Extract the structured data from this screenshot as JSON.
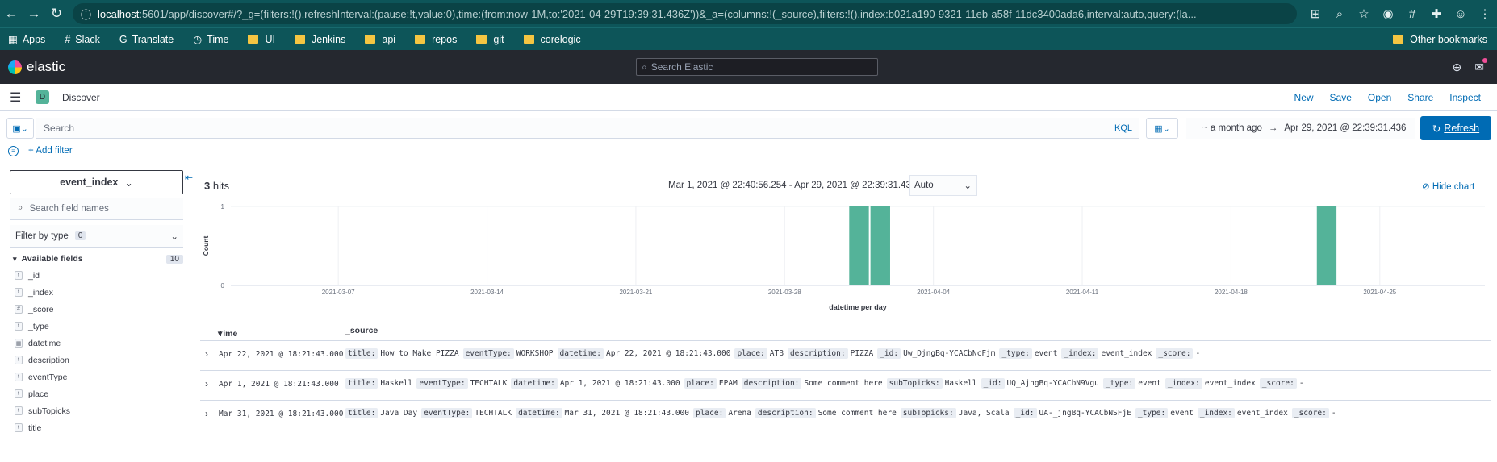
{
  "browser": {
    "url_host": "localhost",
    "url_path": ":5601/app/discover#/?_g=(filters:!(),refreshInterval:(pause:!t,value:0),time:(from:now-1M,to:'2021-04-29T19:39:31.436Z'))&_a=(columns:!(_source),filters:!(),index:b021a190-9321-11eb-a58f-11dc3400ada6,interval:auto,query:(la...",
    "bookmarks": [
      "Apps",
      "Slack",
      "Translate",
      "Time",
      "UI",
      "Jenkins",
      "api",
      "repos",
      "git",
      "corelogic"
    ],
    "other_bookmarks": "Other bookmarks"
  },
  "header": {
    "logo_text": "elastic",
    "search_placeholder": "Search Elastic"
  },
  "app_bar": {
    "badge": "D",
    "title": "Discover",
    "menu": [
      "New",
      "Save",
      "Open",
      "Share",
      "Inspect"
    ]
  },
  "query": {
    "placeholder": "Search",
    "kql": "KQL",
    "date_start": "~ a month ago",
    "date_arrow": "→",
    "date_end": "Apr 29, 2021 @ 22:39:31.436",
    "refresh_label": "Refresh",
    "add_filter": "+ Add filter"
  },
  "sidebar": {
    "index_pattern": "event_index",
    "field_search_placeholder": "Search field names",
    "filter_by_type": "Filter by type",
    "filter_count": "0",
    "available_label": "Available fields",
    "available_count": "10",
    "fields": [
      {
        "type": "t",
        "name": "_id"
      },
      {
        "type": "t",
        "name": "_index"
      },
      {
        "type": "#",
        "name": "_score"
      },
      {
        "type": "t",
        "name": "_type"
      },
      {
        "type": "cal",
        "name": "datetime"
      },
      {
        "type": "t",
        "name": "description"
      },
      {
        "type": "t",
        "name": "eventType"
      },
      {
        "type": "t",
        "name": "place"
      },
      {
        "type": "t",
        "name": "subTopicks"
      },
      {
        "type": "t",
        "name": "title"
      }
    ]
  },
  "results": {
    "hits_count": "3",
    "hits_label": "hits",
    "range": "Mar 1, 2021 @ 22:40:56.254 - Apr 29, 2021 @ 22:39:31.436",
    "interval": "Auto",
    "hide_chart": "Hide chart",
    "col_time": "Time",
    "col_source": "_source",
    "rows": [
      {
        "time": "Apr 22, 2021 @ 18:21:43.000",
        "pairs": [
          [
            "title:",
            "How to Make PIZZA"
          ],
          [
            "eventType:",
            "WORKSHOP"
          ],
          [
            "datetime:",
            "Apr 22, 2021 @ 18:21:43.000"
          ],
          [
            "place:",
            "ATB"
          ],
          [
            "description:",
            "PIZZA"
          ],
          [
            "_id:",
            "Uw_DjngBq-YCACbNcFjm"
          ],
          [
            "_type:",
            "event"
          ],
          [
            "_index:",
            "event_index"
          ],
          [
            "_score:",
            "-"
          ]
        ]
      },
      {
        "time": "Apr 1, 2021 @ 18:21:43.000",
        "pairs": [
          [
            "title:",
            "Haskell"
          ],
          [
            "eventType:",
            "TECHTALK"
          ],
          [
            "datetime:",
            "Apr 1, 2021 @ 18:21:43.000"
          ],
          [
            "place:",
            "EPAM"
          ],
          [
            "description:",
            "Some comment here"
          ],
          [
            "subTopicks:",
            "Haskell"
          ],
          [
            "_id:",
            "UQ_AjngBq-YCACbN9Vgu"
          ],
          [
            "_type:",
            "event"
          ],
          [
            "_index:",
            "event_index"
          ],
          [
            "_score:",
            "-"
          ]
        ]
      },
      {
        "time": "Mar 31, 2021 @ 18:21:43.000",
        "pairs": [
          [
            "title:",
            "Java Day"
          ],
          [
            "eventType:",
            "TECHTALK"
          ],
          [
            "datetime:",
            "Mar 31, 2021 @ 18:21:43.000"
          ],
          [
            "place:",
            "Arena"
          ],
          [
            "description:",
            "Some comment here"
          ],
          [
            "subTopicks:",
            "Java, Scala"
          ],
          [
            "_id:",
            "UA-_jngBq-YCACbNSFjE"
          ],
          [
            "_type:",
            "event"
          ],
          [
            "_index:",
            "event_index"
          ],
          [
            "_score:",
            "-"
          ]
        ]
      }
    ]
  },
  "chart_data": {
    "type": "bar",
    "ylabel": "Count",
    "xlabel": "datetime per day",
    "ylim": [
      0,
      1
    ],
    "yticks": [
      0,
      1
    ],
    "x_ticks": [
      "2021-03-07",
      "2021-03-14",
      "2021-03-21",
      "2021-03-28",
      "2021-04-04",
      "2021-04-11",
      "2021-04-18",
      "2021-04-25"
    ],
    "categories": [
      "2021-03-31",
      "2021-04-01",
      "2021-04-22"
    ],
    "values": [
      1,
      1,
      1
    ],
    "bar_color": "#54b399",
    "grid": true
  }
}
